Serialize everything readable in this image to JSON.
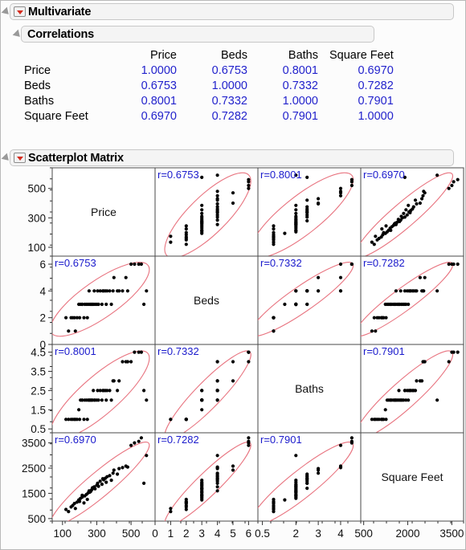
{
  "window": {
    "title": "Multivariate"
  },
  "sections": {
    "multivariate": {
      "title": "Multivariate",
      "menu_icon": "red-triangle-menu-icon",
      "disclosure_icon": "disclosure-triangle-icon"
    },
    "correlations": {
      "title": "Correlations",
      "disclosure_icon": "disclosure-triangle-icon"
    },
    "scatterplot_matrix": {
      "title": "Scatterplot Matrix",
      "menu_icon": "red-triangle-menu-icon",
      "disclosure_icon": "disclosure-triangle-icon"
    }
  },
  "correlations_table": {
    "columns": [
      "Price",
      "Beds",
      "Baths",
      "Square Feet"
    ],
    "rows": [
      {
        "label": "Price",
        "values": [
          "1.0000",
          "0.6753",
          "0.8001",
          "0.6970"
        ]
      },
      {
        "label": "Beds",
        "values": [
          "0.6753",
          "1.0000",
          "0.7332",
          "0.7282"
        ]
      },
      {
        "label": "Baths",
        "values": [
          "0.8001",
          "0.7332",
          "1.0000",
          "0.7901"
        ]
      },
      {
        "label": "Square Feet",
        "values": [
          "0.6970",
          "0.7282",
          "0.7901",
          "1.0000"
        ]
      }
    ],
    "value_color": "#2222cc"
  },
  "chart_data": {
    "type": "scatter",
    "title": "Scatterplot Matrix",
    "variables": [
      "Price",
      "Beds",
      "Baths",
      "Square Feet"
    ],
    "axis_ranges": {
      "Price": [
        40,
        640
      ],
      "Beds": [
        0,
        6.6
      ],
      "Baths": [
        0.3,
        4.9
      ],
      "Square Feet": [
        400,
        3900
      ]
    },
    "axis_ticks": {
      "Price": [
        "100",
        "300",
        "500"
      ],
      "Beds": [
        "0",
        "1",
        "2",
        "3",
        "4",
        "5",
        "6"
      ],
      "Baths": [
        "0.5",
        "2",
        "3",
        "4"
      ],
      "Square Feet": [
        "500",
        "2000",
        "3500"
      ]
    },
    "y_axis_ticks": {
      "Price": [
        "100",
        "300",
        "500"
      ],
      "Beds": [
        "0",
        "2",
        "4",
        "6"
      ],
      "Baths": [
        "0.5",
        "1.5",
        "2.5",
        "3.5",
        "4.5"
      ],
      "Square Feet": [
        "500",
        "1500",
        "2500",
        "3500"
      ]
    },
    "correlation_labels": [
      [
        "",
        "r=0.6753",
        "r=0.8001",
        "r=0.6970"
      ],
      [
        "r=0.6753",
        "",
        "r=0.7332",
        "r=0.7282"
      ],
      [
        "r=0.8001",
        "r=0.7332",
        "",
        "r=0.7901"
      ],
      [
        "r=0.6970",
        "r=0.7282",
        "r=0.7901",
        ""
      ]
    ],
    "ellipse_color": "#e8737f",
    "point_color": "#000000",
    "density_ellipse": true,
    "observations": [
      {
        "Price": 120,
        "Beds": 2,
        "Baths": 1.0,
        "Square Feet": 860
      },
      {
        "Price": 135,
        "Beds": 1,
        "Baths": 1.0,
        "Square Feet": 780
      },
      {
        "Price": 150,
        "Beds": 2,
        "Baths": 1.0,
        "Square Feet": 960
      },
      {
        "Price": 160,
        "Beds": 2,
        "Baths": 1.0,
        "Square Feet": 1020
      },
      {
        "Price": 170,
        "Beds": 2,
        "Baths": 1.0,
        "Square Feet": 1100
      },
      {
        "Price": 175,
        "Beds": 1,
        "Baths": 1.0,
        "Square Feet": 900
      },
      {
        "Price": 185,
        "Beds": 2,
        "Baths": 1.0,
        "Square Feet": 1150
      },
      {
        "Price": 195,
        "Beds": 3,
        "Baths": 1.5,
        "Square Feet": 1240
      },
      {
        "Price": 200,
        "Beds": 2,
        "Baths": 1.0,
        "Square Feet": 1180
      },
      {
        "Price": 205,
        "Beds": 3,
        "Baths": 2.0,
        "Square Feet": 1300
      },
      {
        "Price": 215,
        "Beds": 3,
        "Baths": 2.0,
        "Square Feet": 1350
      },
      {
        "Price": 225,
        "Beds": 2,
        "Baths": 1.0,
        "Square Feet": 1120
      },
      {
        "Price": 230,
        "Beds": 3,
        "Baths": 2.0,
        "Square Feet": 1400
      },
      {
        "Price": 240,
        "Beds": 3,
        "Baths": 2.0,
        "Square Feet": 1460
      },
      {
        "Price": 250,
        "Beds": 3,
        "Baths": 2.0,
        "Square Feet": 1520
      },
      {
        "Price": 255,
        "Beds": 4,
        "Baths": 2.0,
        "Square Feet": 1600
      },
      {
        "Price": 260,
        "Beds": 3,
        "Baths": 2.0,
        "Square Feet": 1550
      },
      {
        "Price": 265,
        "Beds": 3,
        "Baths": 2.0,
        "Square Feet": 1580
      },
      {
        "Price": 270,
        "Beds": 3,
        "Baths": 2.0,
        "Square Feet": 1640
      },
      {
        "Price": 280,
        "Beds": 3,
        "Baths": 2.5,
        "Square Feet": 1700
      },
      {
        "Price": 285,
        "Beds": 4,
        "Baths": 2.0,
        "Square Feet": 1760
      },
      {
        "Price": 290,
        "Beds": 3,
        "Baths": 2.0,
        "Square Feet": 1680
      },
      {
        "Price": 300,
        "Beds": 3,
        "Baths": 2.0,
        "Square Feet": 1820
      },
      {
        "Price": 305,
        "Beds": 4,
        "Baths": 2.5,
        "Square Feet": 1900
      },
      {
        "Price": 310,
        "Beds": 3,
        "Baths": 2.0,
        "Square Feet": 1780
      },
      {
        "Price": 320,
        "Beds": 4,
        "Baths": 2.5,
        "Square Feet": 1980
      },
      {
        "Price": 330,
        "Beds": 3,
        "Baths": 2.0,
        "Square Feet": 1860
      },
      {
        "Price": 340,
        "Beds": 4,
        "Baths": 2.5,
        "Square Feet": 2040
      },
      {
        "Price": 350,
        "Beds": 4,
        "Baths": 2.5,
        "Square Feet": 2100
      },
      {
        "Price": 355,
        "Beds": 3,
        "Baths": 2.0,
        "Square Feet": 1940
      },
      {
        "Price": 360,
        "Beds": 4,
        "Baths": 2.5,
        "Square Feet": 2160
      },
      {
        "Price": 375,
        "Beds": 4,
        "Baths": 2.5,
        "Square Feet": 2200
      },
      {
        "Price": 385,
        "Beds": 3,
        "Baths": 2.0,
        "Square Feet": 2020
      },
      {
        "Price": 395,
        "Beds": 4,
        "Baths": 3.0,
        "Square Feet": 2300
      },
      {
        "Price": 400,
        "Beds": 5,
        "Baths": 3.0,
        "Square Feet": 2420
      },
      {
        "Price": 420,
        "Beds": 4,
        "Baths": 2.5,
        "Square Feet": 2260
      },
      {
        "Price": 430,
        "Beds": 4,
        "Baths": 3.0,
        "Square Feet": 2480
      },
      {
        "Price": 450,
        "Beds": 4,
        "Baths": 4.0,
        "Square Feet": 2520
      },
      {
        "Price": 470,
        "Beds": 5,
        "Baths": 4.0,
        "Square Feet": 2580
      },
      {
        "Price": 480,
        "Beds": 4,
        "Baths": 4.0,
        "Square Feet": 2540
      },
      {
        "Price": 500,
        "Beds": 6,
        "Baths": 4.0,
        "Square Feet": 3400
      },
      {
        "Price": 520,
        "Beds": 6,
        "Baths": 4.5,
        "Square Feet": 3500
      },
      {
        "Price": 545,
        "Beds": 6,
        "Baths": 4.5,
        "Square Feet": 3560
      },
      {
        "Price": 560,
        "Beds": 6,
        "Baths": 4.5,
        "Square Feet": 3700
      },
      {
        "Price": 575,
        "Beds": 3,
        "Baths": 2.5,
        "Square Feet": 1900
      },
      {
        "Price": 590,
        "Beds": 4,
        "Baths": 2.0,
        "Square Feet": 3000
      },
      {
        "Price": 245,
        "Beds": 2,
        "Baths": 1.0,
        "Square Feet": 1260
      },
      {
        "Price": 215,
        "Beds": 3,
        "Baths": 2.0,
        "Square Feet": 1420
      },
      {
        "Price": 335,
        "Beds": 4,
        "Baths": 2.5,
        "Square Feet": 2080
      },
      {
        "Price": 275,
        "Beds": 3,
        "Baths": 2.0,
        "Square Feet": 1720
      }
    ]
  }
}
